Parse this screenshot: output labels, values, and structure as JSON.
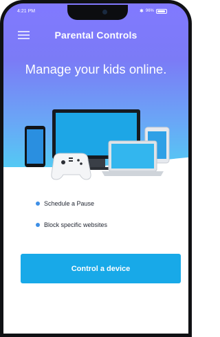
{
  "status_bar": {
    "time": "4:21 PM",
    "battery": "96%"
  },
  "header": {
    "title": "Parental Controls"
  },
  "hero": {
    "subtitle": "Manage your kids online."
  },
  "features": [
    {
      "label": "Schedule a Pause"
    },
    {
      "label": "Block specific websites"
    }
  ],
  "cta": {
    "label": "Control a device"
  },
  "colors": {
    "gradient_top": "#8179ff",
    "gradient_bottom": "#54c9f4",
    "accent": "#18a9e8",
    "bullet": "#3e8fe6"
  }
}
